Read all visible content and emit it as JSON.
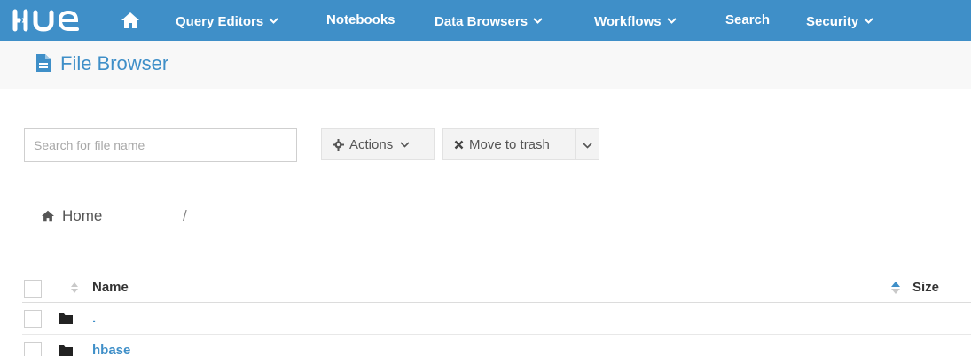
{
  "app": {
    "logo_text": "HUE",
    "brand_color": "#3f8fc8"
  },
  "nav": {
    "home_icon": "home-icon",
    "items": [
      {
        "label": "Query Editors",
        "dropdown": true
      },
      {
        "label": "Notebooks",
        "dropdown": false
      },
      {
        "label": "Data Browsers",
        "dropdown": true
      },
      {
        "label": "Workflows",
        "dropdown": true
      },
      {
        "label": "Search",
        "dropdown": false
      },
      {
        "label": "Security",
        "dropdown": true
      }
    ]
  },
  "page": {
    "title": "File Browser",
    "title_icon": "file-icon"
  },
  "toolbar": {
    "search_placeholder": "Search for file name",
    "search_value": "",
    "actions_label": "Actions",
    "move_to_trash_label": "Move to trash"
  },
  "breadcrumb": {
    "home_label": "Home",
    "separator": "/"
  },
  "table": {
    "columns": {
      "name": "Name",
      "size": "Size"
    },
    "rows": [
      {
        "type": "folder",
        "name": "."
      },
      {
        "type": "folder",
        "name": "hbase"
      }
    ]
  }
}
